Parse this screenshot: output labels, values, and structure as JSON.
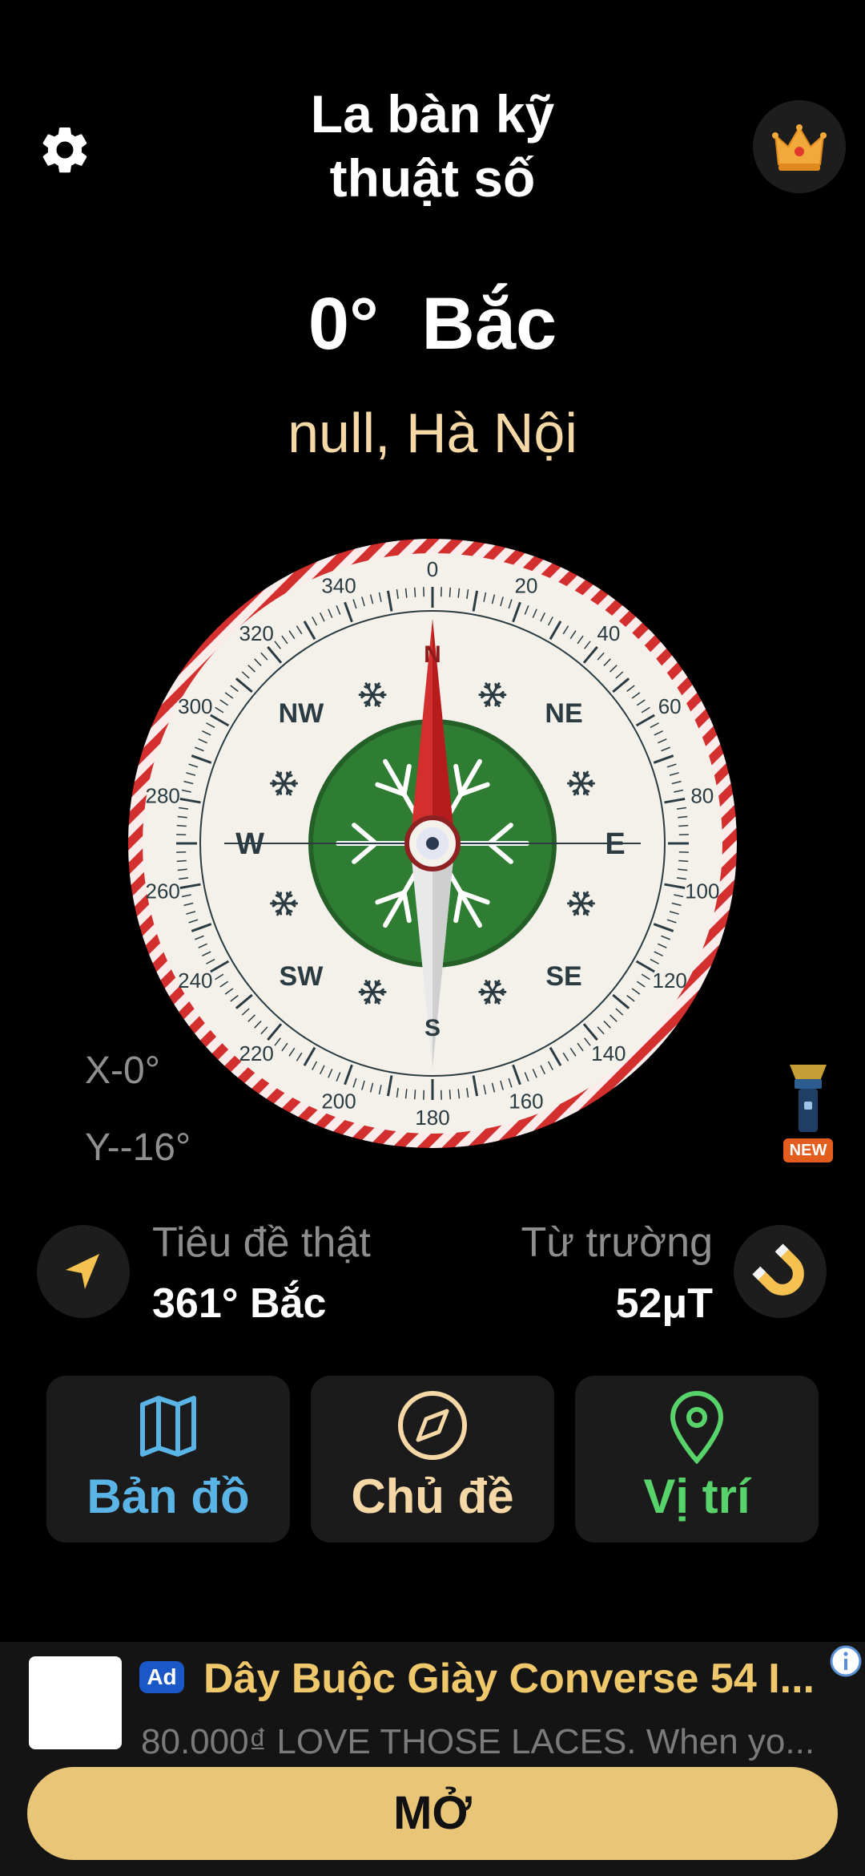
{
  "header": {
    "title_line1": "La bàn kỹ",
    "title_line2": "thuật số",
    "settings_icon": "gear-icon",
    "premium_icon": "crown-icon"
  },
  "heading": {
    "degrees": "0°",
    "direction": "Bắc"
  },
  "location": "null, Hà Nội",
  "compass": {
    "heading_deg": 0,
    "degree_labels": [
      "0",
      "20",
      "40",
      "60",
      "80",
      "100",
      "120",
      "140",
      "160",
      "180",
      "200",
      "220",
      "240",
      "260",
      "280",
      "300",
      "320",
      "340"
    ],
    "cardinals": [
      "N",
      "E",
      "S",
      "W"
    ],
    "intercardinals": [
      "NE",
      "SE",
      "SW",
      "NW"
    ],
    "ring_color": "#d32f2f",
    "center_color": "#2e7d32"
  },
  "tilt": {
    "x": "X-0°",
    "y": "Y--16°"
  },
  "flashlight": {
    "badge": "NEW",
    "icon": "flashlight-icon"
  },
  "info": {
    "true_heading_label": "Tiêu đề thật",
    "true_heading_value": "361° Bắc",
    "magnetic_label": "Từ trường",
    "magnetic_value": "52μT"
  },
  "cards": {
    "map_label": "Bản đồ",
    "theme_label": "Chủ đề",
    "location_label": "Vị trí",
    "map_color": "#5ab4e6",
    "theme_color": "#f5d8a6",
    "location_color": "#58d26a"
  },
  "ad": {
    "badge": "Ad",
    "title": "Dây Buộc Giày Converse 54 I...",
    "description": "80.000₫ LOVE THOSE LACES. When yo...",
    "cta": "MỞ"
  }
}
